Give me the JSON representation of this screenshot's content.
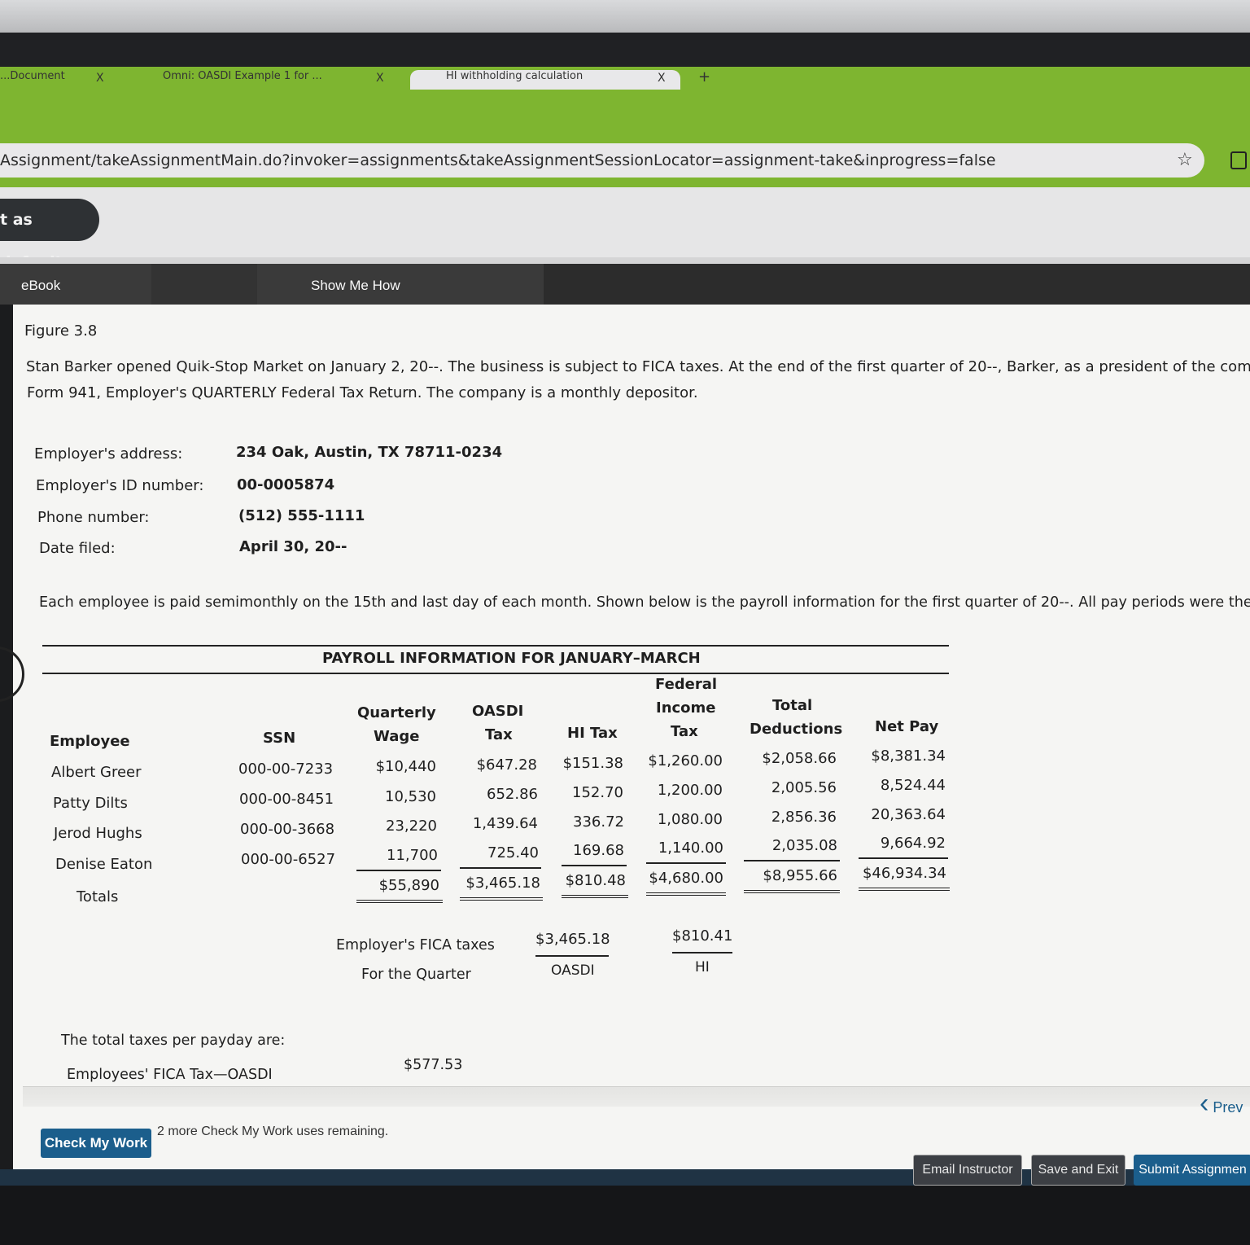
{
  "browser": {
    "tabs": [
      {
        "label": "...Document",
        "close": "X"
      },
      {
        "label": "Omni: OASDI Example 1 for ...",
        "close": "X"
      },
      {
        "label": "HI withholding calculation",
        "close": "X"
      }
    ],
    "new_tab": "+",
    "url": "Assignment/takeAssignmentMain.do?invoker=assignments&takeAssignmentSessionLocator=assignment-take&inprogress=false",
    "set_default_label": "t as default"
  },
  "nav": {
    "ebook": "eBook",
    "show_me_how": "Show Me How"
  },
  "content": {
    "figure": "Figure 3.8",
    "intro_line1": "Stan Barker opened Quik-Stop Market on January 2, 20--. The business is subject to FICA taxes. At the end of the first quarter of 20--, Barker, as a president of the company, m",
    "intro_line2": "Form 941, Employer's QUARTERLY Federal Tax Return. The company is a monthly depositor.",
    "employer": [
      {
        "label": "Employer's address:",
        "value": "234 Oak, Austin, TX 78711-0234"
      },
      {
        "label": "Employer's ID number:",
        "value": "00-0005874"
      },
      {
        "label": "Phone number:",
        "value": "(512) 555-1111"
      },
      {
        "label": "Date filed:",
        "value": "April 30, 20--"
      }
    ],
    "pay_info": "Each employee is paid semimonthly on the 15th and last day of each month. Shown below is the payroll information for the first quarter of 20--. All pay periods were the same."
  },
  "payroll": {
    "title": "PAYROLL INFORMATION FOR JANUARY–MARCH",
    "headers": {
      "employee": "Employee",
      "ssn": "SSN",
      "wage_1": "Quarterly",
      "wage_2": "Wage",
      "oasdi_1": "OASDI",
      "oasdi_2": "Tax",
      "hi": "HI Tax",
      "fed_1": "Federal",
      "fed_2": "Income",
      "fed_3": "Tax",
      "ded_1": "Total",
      "ded_2": "Deductions",
      "net": "Net Pay"
    },
    "rows": [
      {
        "name": "Albert Greer",
        "ssn": "000-00-7233",
        "wage": "$10,440",
        "oasdi": "$647.28",
        "hi": "$151.38",
        "fed": "$1,260.00",
        "ded": "$2,058.66",
        "net": "$8,381.34"
      },
      {
        "name": "Patty Dilts",
        "ssn": "000-00-8451",
        "wage": "10,530",
        "oasdi": "652.86",
        "hi": "152.70",
        "fed": "1,200.00",
        "ded": "2,005.56",
        "net": "8,524.44"
      },
      {
        "name": "Jerod Hughs",
        "ssn": "000-00-3668",
        "wage": "23,220",
        "oasdi": "1,439.64",
        "hi": "336.72",
        "fed": "1,080.00",
        "ded": "2,856.36",
        "net": "20,363.64"
      },
      {
        "name": "Denise Eaton",
        "ssn": "000-00-6527",
        "wage": "11,700",
        "oasdi": "725.40",
        "hi": "169.68",
        "fed": "1,140.00",
        "ded": "2,035.08",
        "net": "9,664.92"
      }
    ],
    "totals": {
      "label": "Totals",
      "wage": "$55,890",
      "oasdi": "$3,465.18",
      "hi": "$810.48",
      "fed": "$4,680.00",
      "ded": "$8,955.66",
      "net": "$46,934.34"
    },
    "employer_fica": {
      "label_1": "Employer's FICA taxes",
      "label_2": "For the Quarter",
      "oasdi_value": "$3,465.18",
      "oasdi_label": "OASDI",
      "hi_value": "$810.41",
      "hi_label": "HI"
    }
  },
  "per_payday": {
    "title": "The total taxes per payday are:",
    "item_label": "Employees' FICA Tax—OASDI",
    "item_value": "$577.53"
  },
  "bottom": {
    "check_my_work": "Check My Work",
    "uses_remaining": "2 more Check My Work uses remaining.",
    "prev": "Prev",
    "email_instructor": "Email Instructor",
    "save_exit": "Save and Exit",
    "submit": "Submit Assignmen"
  },
  "colors": {
    "browser_green": "#7eb530",
    "accent_blue": "#1b5e8c",
    "nav_dark": "#2c2c2c"
  }
}
